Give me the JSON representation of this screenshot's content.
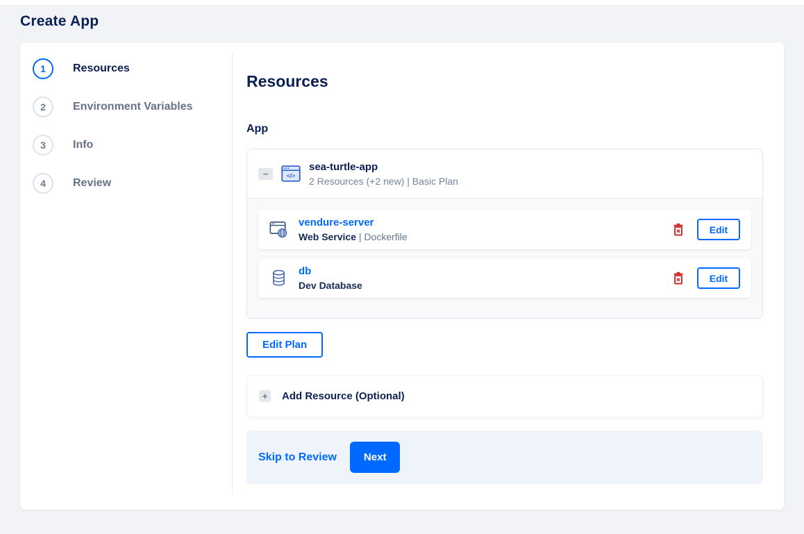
{
  "page": {
    "title": "Create App"
  },
  "stepper": {
    "steps": [
      {
        "number": "1",
        "label": "Resources"
      },
      {
        "number": "2",
        "label": "Environment Variables"
      },
      {
        "number": "3",
        "label": "Info"
      },
      {
        "number": "4",
        "label": "Review"
      }
    ]
  },
  "content": {
    "heading": "Resources",
    "section_label": "App",
    "app_group": {
      "collapse_glyph": "−",
      "name": "sea-turtle-app",
      "summary": "2 Resources (+2 new) | Basic Plan",
      "edit_button_label": "Edit",
      "resources": [
        {
          "name": "vendure-server",
          "type": "Web Service",
          "separator": " | ",
          "detail": "Dockerfile"
        },
        {
          "name": "db",
          "type": "Dev Database",
          "separator": "",
          "detail": ""
        }
      ]
    },
    "edit_plan_label": "Edit Plan",
    "add_resource": {
      "plus_glyph": "+",
      "label": "Add Resource (Optional)"
    },
    "footer": {
      "skip_label": "Skip to Review",
      "next_label": "Next"
    }
  },
  "colors": {
    "accent": "#0069ff",
    "navy": "#0b1f52",
    "muted_text": "#76839a",
    "danger": "#d12f2f",
    "page_background": "#f1f3f7",
    "footer_background": "#eef4fa"
  }
}
